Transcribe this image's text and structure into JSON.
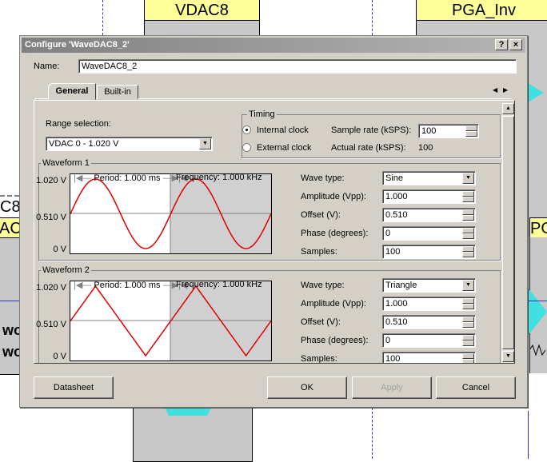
{
  "background": {
    "vdac_label": "VDAC8",
    "pga_label": "PGA_Inv",
    "left_partial_1": "C8",
    "left_partial_2": "AC",
    "left_partial_3": "wo",
    "left_partial_4": "wo",
    "right_partial": "PG"
  },
  "dialog": {
    "title": "Configure 'WaveDAC8_2'",
    "help_label": "?",
    "close_label": "×",
    "name_label": "Name:",
    "name_value": "WaveDAC8_2",
    "tabs": [
      "General",
      "Built-in"
    ],
    "active_tab": "General",
    "tab_scroll_left": "◀",
    "tab_scroll_right": "▶"
  },
  "general": {
    "range_label": "Range selection:",
    "range_value": "VDAC 0 - 1.020 V",
    "timing": {
      "title": "Timing",
      "internal_label": "Internal clock",
      "external_label": "External clock",
      "selected": "Internal clock",
      "sample_rate_label": "Sample rate (kSPS):",
      "sample_rate_value": "100",
      "actual_rate_label": "Actual rate (kSPS):",
      "actual_rate_value": "100"
    },
    "waveforms": [
      {
        "title": "Waveform 1",
        "period": "Period: 1.000 ms",
        "frequency": "Frequency: 1.000 kHz",
        "y_top": "1.020 V",
        "y_mid": "0.510 V",
        "y_bottom": "0 V",
        "wave_type_label": "Wave type:",
        "wave_type": "Sine",
        "amplitude_label": "Amplitude (Vpp):",
        "amplitude": "1.000",
        "offset_label": "Offset (V):",
        "offset": "0.510",
        "phase_label": "Phase (degrees):",
        "phase": "0",
        "samples_label": "Samples:",
        "samples": "100"
      },
      {
        "title": "Waveform 2",
        "period": "Period: 1.000 ms",
        "frequency": "Frequency: 1.000 kHz",
        "y_top": "1.020 V",
        "y_mid": "0.510 V",
        "y_bottom": "0 V",
        "wave_type_label": "Wave type:",
        "wave_type": "Triangle",
        "amplitude_label": "Amplitude (Vpp):",
        "amplitude": "1.000",
        "offset_label": "Offset (V):",
        "offset": "0.510",
        "phase_label": "Phase (degrees):",
        "phase": "0",
        "samples_label": "Samples:",
        "samples": "100"
      }
    ]
  },
  "buttons": {
    "datasheet": "Datasheet",
    "ok": "OK",
    "apply": "Apply",
    "cancel": "Cancel"
  },
  "colors": {
    "wave": "#e00000",
    "accent_cyan": "#40e0e0",
    "block_yellow": "#ffff99"
  }
}
